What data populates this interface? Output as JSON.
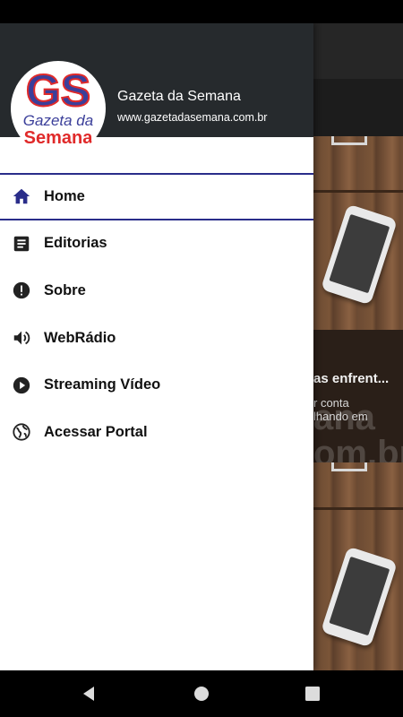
{
  "drawer": {
    "site_name": "Gazeta da Semana",
    "site_url": "www.gazetadasemana.com.br",
    "logo": {
      "initials": "GS",
      "line1": "Gazeta da",
      "line2": "Semana",
      "colors": {
        "blue": "#3b3f9a",
        "red": "#e02a2a"
      }
    },
    "menu": [
      {
        "label": "Home",
        "icon": "home-icon",
        "active": true
      },
      {
        "label": "Editorias",
        "icon": "article-icon"
      },
      {
        "label": "Sobre",
        "icon": "info-icon"
      },
      {
        "label": "WebRádio",
        "icon": "volume-icon"
      },
      {
        "label": "Streaming Vídeo",
        "icon": "play-icon"
      },
      {
        "label": "Acessar Portal",
        "icon": "globe-icon"
      }
    ],
    "accent": "#2a2d8a"
  },
  "background": {
    "headline": "as enfrent...",
    "excerpt_line1": "r conta",
    "excerpt_line2": "lhando em",
    "watermark_line1": "ana",
    "watermark_line2": "om.br"
  },
  "navbar": {
    "icons": [
      "back-icon",
      "home-circle-icon",
      "recents-icon"
    ]
  }
}
